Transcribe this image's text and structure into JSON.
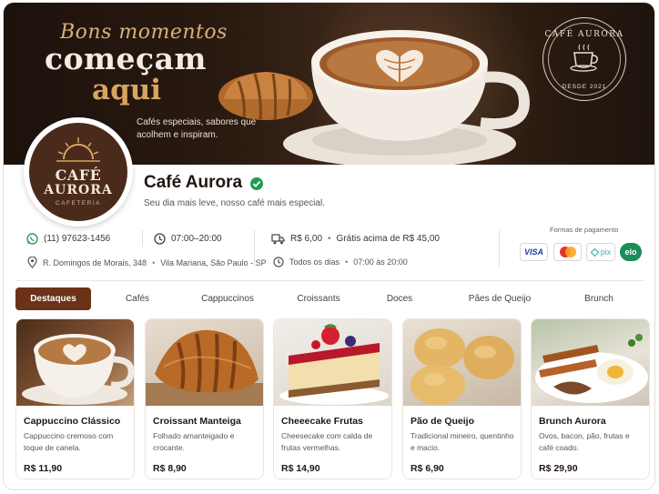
{
  "hero": {
    "line1": "Bons momentos",
    "line2": "começam",
    "line3": "aqui",
    "subtitle": "Cafés especiais, sabores que acolhem e inspiram.",
    "seal_title": "CAFÉ AURORA",
    "seal_sub": "DESDE 2021"
  },
  "logo": {
    "cafe": "CAFÉ",
    "aurora": "AURORA",
    "tagline": "CAFETERIA"
  },
  "store": {
    "name": "Café Aurora",
    "tagline": "Seu dia mais leve, nosso café mais especial."
  },
  "info": {
    "phone": "(11) 97623-1456",
    "address": "R. Domingos de Morais, 348",
    "district": "Vila Mariana, São Paulo - SP",
    "hours": "07:00–20:00",
    "delivery_fee": "R$ 6,00",
    "free_delivery": "Grátis acima de R$ 45,00",
    "schedule_days": "Todos os dias",
    "schedule_hours": "07:00 às 20:00"
  },
  "payments": {
    "title": "Formas de pagamento",
    "visa": "VISA",
    "pix": "pix",
    "elo": "elo"
  },
  "tabs": [
    "Destaques",
    "Cafés",
    "Cappuccinos",
    "Croissants",
    "Doces",
    "Pães de Queijo",
    "Brunch"
  ],
  "products": [
    {
      "name": "Cappuccino Clássico",
      "desc": "Cappuccino cremoso com toque de canela.",
      "price": "R$ 11,90"
    },
    {
      "name": "Croissant Manteiga",
      "desc": "Folhado amanteigado e crocante.",
      "price": "R$ 8,90"
    },
    {
      "name": "Cheeecake Frutas",
      "desc": "Cheesecake com calda de frutas vermelhas.",
      "price": "R$ 14,90"
    },
    {
      "name": "Pão de Queijo",
      "desc": "Tradicional mineiro, quentinho e macio.",
      "price": "R$ 6,90"
    },
    {
      "name": "Brunch Aurora",
      "desc": "Ovos, bacon, pão, frutas e café coado.",
      "price": "R$ 29,90"
    }
  ],
  "colors": {
    "brand": "#6b3218",
    "hero_dark": "#1c120c",
    "gold": "#d8a560",
    "verified": "#1f9d55"
  }
}
